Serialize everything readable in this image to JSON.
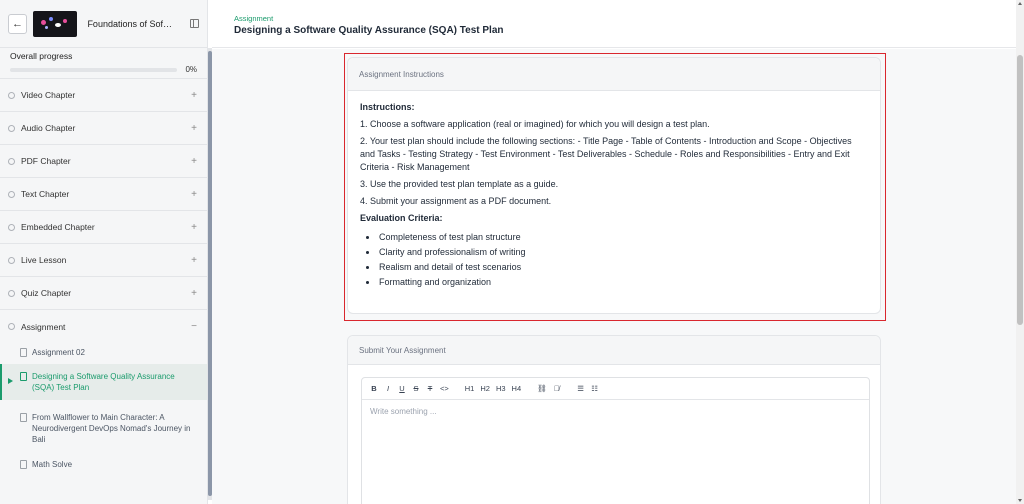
{
  "sidebar": {
    "back_icon": "arrow-left-icon",
    "course_title": "Foundations of Software Quality Assurance",
    "progress_label": "Overall progress",
    "progress_percent": "0%",
    "progress_value": 0,
    "chapters": [
      {
        "label": "Video Chapter",
        "toggle": "+"
      },
      {
        "label": "Audio Chapter",
        "toggle": "+"
      },
      {
        "label": "PDF Chapter",
        "toggle": "+"
      },
      {
        "label": "Text Chapter",
        "toggle": "+"
      },
      {
        "label": "Embedded Chapter",
        "toggle": "+"
      },
      {
        "label": "Live Lesson",
        "toggle": "+"
      },
      {
        "label": "Quiz Chapter",
        "toggle": "+"
      },
      {
        "label": "Assignment",
        "toggle": "−"
      }
    ],
    "assignment_items": [
      {
        "label": "Assignment 02"
      },
      {
        "label": "Designing a Software Quality Assurance (SQA) Test Plan"
      },
      {
        "label": "From Wallflower to Main Character: A Neurodivergent DevOps Nomad's Journey in Bali"
      },
      {
        "label": "Math Solve"
      }
    ]
  },
  "header": {
    "breadcrumb": "Assignment",
    "title": "Designing a Software Quality Assurance (SQA) Test Plan"
  },
  "instructions_card": {
    "heading": "Assignment Instructions",
    "instructions_label": "Instructions:",
    "steps": [
      "1. Choose a software application (real or imagined) for which you will design a test plan.",
      "2. Your test plan should include the following sections: - Title Page - Table of Contents - Introduction and Scope - Objectives and Tasks - Testing Strategy - Test Environment - Test Deliverables - Schedule - Roles and Responsibilities - Entry and Exit Criteria - Risk Management",
      "3. Use the provided test plan template as a guide.",
      "4. Submit your assignment as a PDF document."
    ],
    "criteria_label": "Evaluation Criteria:",
    "criteria": [
      "Completeness of test plan structure",
      "Clarity and professionalism of writing",
      "Realism and detail of test scenarios",
      "Formatting and organization"
    ]
  },
  "submit_card": {
    "heading": "Submit Your Assignment",
    "toolbar": {
      "bold": "B",
      "italic": "I",
      "underline": "U",
      "strike": "S",
      "clear_format": "T",
      "code": "<>",
      "h1": "H1",
      "h2": "H2",
      "h3": "H3",
      "h4": "H4",
      "link": "⛓",
      "unlink": "⛓̸",
      "bullet_list": "☰",
      "ordered_list": "☷"
    },
    "editor_placeholder": "Write something ..."
  },
  "colors": {
    "accent": "#1a9b6c",
    "highlight": "#d9272e"
  }
}
